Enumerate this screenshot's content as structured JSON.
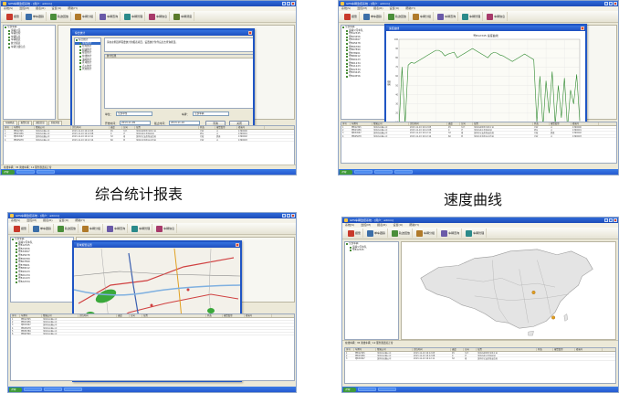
{
  "captions": {
    "report": "综合统计报表",
    "speed": "速度曲线"
  },
  "app": {
    "title": "GPS车辆监控系统 - [用户：admin]",
    "menu": [
      "系统(S)",
      "监控(M)",
      "报表(R)",
      "设置(O)",
      "帮助(H)"
    ],
    "toolbar": [
      "报警",
      "单车跟踪",
      "轨迹回放",
      "车辆分组",
      "车辆查询",
      "车辆管理",
      "车辆信息",
      "车辆调度",
      "车辆上下线",
      "系统管理"
    ],
    "speed_input_placeholder": "车牌号码",
    "speed_button": "查询"
  },
  "panel1": {
    "tree": [
      "全部车辆",
      "运输公司",
      "车辆管理",
      "车辆信息",
      "车辆报表",
      "统计报表",
      "车辆分组信息"
    ],
    "dialog_title": "综合统计",
    "left_list": [
      "综合统计",
      "里程统计",
      "停车统计",
      "超速统计",
      "报警统计",
      "在线统计",
      "油耗统计",
      "区域统计",
      "点火统计",
      "状态统计"
    ],
    "notice": "请在左侧选择需要统计的报表项目，设置统计条件后点击查询按钮。",
    "section_title": "统计结果",
    "label_company": "单位：",
    "company_value": "全部单位",
    "label_plate": "车牌：",
    "plate_value": "全部车辆",
    "label_start": "开始时间：",
    "start_value": "2013-11-09",
    "label_end": "截止时间：",
    "end_value": "2013-11-10",
    "btn_query": "查询",
    "btn_close": "关闭"
  },
  "panel2": {
    "tree": [
      "全部车辆",
      "运输公司车队",
      "粤B12345",
      "粤B23456",
      "粤B34567",
      "粤B45678",
      "粤B56789",
      "粤B67890",
      "粤B78901",
      "粤B89012",
      "粤B90123",
      "粤B01234",
      "粤B11223",
      "粤B22334",
      "粤B33445",
      "粤B44556"
    ],
    "dialog_title": "速度曲线",
    "chart_title": "粤B12345 速度曲线",
    "ylabel": "速度",
    "btn_print": "打印",
    "btn_close": "关闭"
  },
  "panel3": {
    "tree": [
      "全部车辆",
      "运输公司车队",
      "粤B12345",
      "粤B23456",
      "粤B34567",
      "粤B45678",
      "粤B56789",
      "粤B67890",
      "粤B78901",
      "粤B89012",
      "粤B90123",
      "粤B01234",
      "粤B11223",
      "粤B22334"
    ],
    "dialog_title": "区域报警设置",
    "label_name": "区域名称：",
    "label_time": "报警时间：",
    "btn_ok": "确定",
    "btn_cancel": "取消"
  },
  "panel4": {
    "tree": [
      "全部车辆",
      "运输公司车队",
      "粤B12345"
    ]
  },
  "grid": {
    "headers": [
      "序号",
      "车牌号",
      "所属公司",
      "定位时间",
      "速度",
      "方向",
      "位置",
      "状态",
      "报警类型",
      "终端号"
    ],
    "rows": [
      [
        "1",
        "粤B12345",
        "深圳市运输公司",
        "2013-11-10 10:12:05",
        "45",
        "东北",
        "深圳市福田区深南大道",
        "行驶",
        "无",
        "1390000"
      ],
      [
        "2",
        "粤B23456",
        "深圳市运输公司",
        "2013-11-10 10:12:08",
        "0",
        "北",
        "深圳市南山区科技园",
        "停车",
        "无",
        "1390001"
      ],
      [
        "3",
        "粤B34567",
        "深圳市运输公司",
        "2013-11-10 10:12:11",
        "32",
        "南",
        "深圳市宝安区新安街道",
        "行驶",
        "超速",
        "1390002"
      ],
      [
        "4",
        "粤B45678",
        "深圳市运输公司",
        "2013-11-10 10:12:14",
        "60",
        "西",
        "深圳市龙岗区布吉街道",
        "行驶",
        "无",
        "1390003"
      ],
      [
        "5",
        "粤B56789",
        "深圳市运输公司",
        "2013-11-10 10:12:17",
        "12",
        "东",
        "深圳市罗湖区人民南路",
        "行驶",
        "无",
        "1390004"
      ],
      [
        "6",
        "粤B67890",
        "深圳市运输公司",
        "2013-11-10 10:12:20",
        "0",
        "北",
        "深圳市盐田区沙头角",
        "停车",
        "无",
        "1390005"
      ]
    ],
    "tabs": [
      "车辆列表",
      "报警信息",
      "调度信息",
      "系统消息"
    ]
  },
  "status": {
    "text": "在线车辆：35  离线车辆：12  服务器连接正常",
    "start": "开始"
  },
  "colors": {
    "titlebar": "#1c4cb8",
    "window_bg": "#ece9d8",
    "speed_line": "#2f8a2f",
    "map_road": "#d04040"
  },
  "chart_data": {
    "type": "line",
    "title": "粤B12345 速度曲线",
    "xlabel": "",
    "ylabel": "速度",
    "ylim": [
      0,
      100
    ],
    "x": [
      1,
      2,
      3,
      4,
      5,
      6,
      7,
      8,
      9,
      10,
      11,
      12,
      13,
      14,
      15,
      16,
      17,
      18,
      19,
      20,
      21,
      22,
      23,
      24,
      25,
      26,
      27,
      28,
      29,
      30,
      31,
      32,
      33,
      34,
      35,
      36,
      37,
      38,
      39,
      40,
      41,
      42,
      43,
      44,
      45,
      46,
      47,
      48,
      49,
      50,
      51,
      52,
      53,
      54,
      55,
      56,
      57,
      58,
      59,
      60
    ],
    "series": [
      {
        "values": [
          5,
          70,
          8,
          72,
          75,
          74,
          76,
          78,
          80,
          82,
          84,
          86,
          88,
          88,
          86,
          82,
          84,
          85,
          86,
          80,
          82,
          84,
          86,
          88,
          90,
          88,
          86,
          84,
          82,
          80,
          84,
          86,
          85,
          83,
          82,
          80,
          78,
          76,
          78,
          80,
          82,
          84,
          82,
          80,
          78,
          10,
          60,
          5,
          55,
          20,
          65,
          8,
          50,
          15,
          58,
          4,
          45,
          30,
          62,
          12
        ]
      }
    ]
  }
}
